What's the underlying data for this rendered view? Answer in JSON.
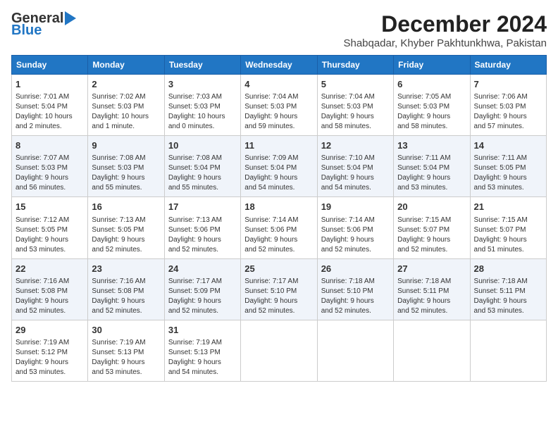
{
  "header": {
    "logo_line1": "General",
    "logo_line2": "Blue",
    "title": "December 2024",
    "subtitle": "Shabqadar, Khyber Pakhtunkhwa, Pakistan"
  },
  "days_of_week": [
    "Sunday",
    "Monday",
    "Tuesday",
    "Wednesday",
    "Thursday",
    "Friday",
    "Saturday"
  ],
  "weeks": [
    [
      {
        "day": 1,
        "info": "Sunrise: 7:01 AM\nSunset: 5:04 PM\nDaylight: 10 hours\nand 2 minutes."
      },
      {
        "day": 2,
        "info": "Sunrise: 7:02 AM\nSunset: 5:03 PM\nDaylight: 10 hours\nand 1 minute."
      },
      {
        "day": 3,
        "info": "Sunrise: 7:03 AM\nSunset: 5:03 PM\nDaylight: 10 hours\nand 0 minutes."
      },
      {
        "day": 4,
        "info": "Sunrise: 7:04 AM\nSunset: 5:03 PM\nDaylight: 9 hours\nand 59 minutes."
      },
      {
        "day": 5,
        "info": "Sunrise: 7:04 AM\nSunset: 5:03 PM\nDaylight: 9 hours\nand 58 minutes."
      },
      {
        "day": 6,
        "info": "Sunrise: 7:05 AM\nSunset: 5:03 PM\nDaylight: 9 hours\nand 58 minutes."
      },
      {
        "day": 7,
        "info": "Sunrise: 7:06 AM\nSunset: 5:03 PM\nDaylight: 9 hours\nand 57 minutes."
      }
    ],
    [
      {
        "day": 8,
        "info": "Sunrise: 7:07 AM\nSunset: 5:03 PM\nDaylight: 9 hours\nand 56 minutes."
      },
      {
        "day": 9,
        "info": "Sunrise: 7:08 AM\nSunset: 5:03 PM\nDaylight: 9 hours\nand 55 minutes."
      },
      {
        "day": 10,
        "info": "Sunrise: 7:08 AM\nSunset: 5:04 PM\nDaylight: 9 hours\nand 55 minutes."
      },
      {
        "day": 11,
        "info": "Sunrise: 7:09 AM\nSunset: 5:04 PM\nDaylight: 9 hours\nand 54 minutes."
      },
      {
        "day": 12,
        "info": "Sunrise: 7:10 AM\nSunset: 5:04 PM\nDaylight: 9 hours\nand 54 minutes."
      },
      {
        "day": 13,
        "info": "Sunrise: 7:11 AM\nSunset: 5:04 PM\nDaylight: 9 hours\nand 53 minutes."
      },
      {
        "day": 14,
        "info": "Sunrise: 7:11 AM\nSunset: 5:05 PM\nDaylight: 9 hours\nand 53 minutes."
      }
    ],
    [
      {
        "day": 15,
        "info": "Sunrise: 7:12 AM\nSunset: 5:05 PM\nDaylight: 9 hours\nand 53 minutes."
      },
      {
        "day": 16,
        "info": "Sunrise: 7:13 AM\nSunset: 5:05 PM\nDaylight: 9 hours\nand 52 minutes."
      },
      {
        "day": 17,
        "info": "Sunrise: 7:13 AM\nSunset: 5:06 PM\nDaylight: 9 hours\nand 52 minutes."
      },
      {
        "day": 18,
        "info": "Sunrise: 7:14 AM\nSunset: 5:06 PM\nDaylight: 9 hours\nand 52 minutes."
      },
      {
        "day": 19,
        "info": "Sunrise: 7:14 AM\nSunset: 5:06 PM\nDaylight: 9 hours\nand 52 minutes."
      },
      {
        "day": 20,
        "info": "Sunrise: 7:15 AM\nSunset: 5:07 PM\nDaylight: 9 hours\nand 52 minutes."
      },
      {
        "day": 21,
        "info": "Sunrise: 7:15 AM\nSunset: 5:07 PM\nDaylight: 9 hours\nand 51 minutes."
      }
    ],
    [
      {
        "day": 22,
        "info": "Sunrise: 7:16 AM\nSunset: 5:08 PM\nDaylight: 9 hours\nand 52 minutes."
      },
      {
        "day": 23,
        "info": "Sunrise: 7:16 AM\nSunset: 5:08 PM\nDaylight: 9 hours\nand 52 minutes."
      },
      {
        "day": 24,
        "info": "Sunrise: 7:17 AM\nSunset: 5:09 PM\nDaylight: 9 hours\nand 52 minutes."
      },
      {
        "day": 25,
        "info": "Sunrise: 7:17 AM\nSunset: 5:10 PM\nDaylight: 9 hours\nand 52 minutes."
      },
      {
        "day": 26,
        "info": "Sunrise: 7:18 AM\nSunset: 5:10 PM\nDaylight: 9 hours\nand 52 minutes."
      },
      {
        "day": 27,
        "info": "Sunrise: 7:18 AM\nSunset: 5:11 PM\nDaylight: 9 hours\nand 52 minutes."
      },
      {
        "day": 28,
        "info": "Sunrise: 7:18 AM\nSunset: 5:11 PM\nDaylight: 9 hours\nand 53 minutes."
      }
    ],
    [
      {
        "day": 29,
        "info": "Sunrise: 7:19 AM\nSunset: 5:12 PM\nDaylight: 9 hours\nand 53 minutes."
      },
      {
        "day": 30,
        "info": "Sunrise: 7:19 AM\nSunset: 5:13 PM\nDaylight: 9 hours\nand 53 minutes."
      },
      {
        "day": 31,
        "info": "Sunrise: 7:19 AM\nSunset: 5:13 PM\nDaylight: 9 hours\nand 54 minutes."
      },
      null,
      null,
      null,
      null
    ]
  ]
}
